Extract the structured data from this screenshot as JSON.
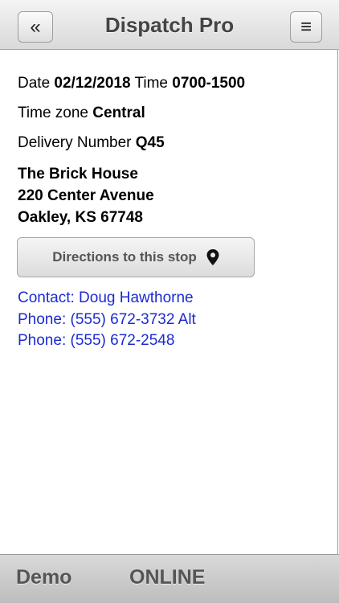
{
  "header": {
    "back_icon": "double-chevron-left-icon",
    "back_glyph": "«",
    "title": "Dispatch Pro",
    "menu_icon": "hamburger-menu-icon",
    "menu_glyph": "≡"
  },
  "stop": {
    "date_label": "Date",
    "date_value": "02/12/2018",
    "time_label": "Time",
    "time_value": "0700-1500",
    "timezone_label": "Time zone",
    "timezone_value": "Central",
    "delivery_label": "Delivery Number",
    "delivery_value": "Q45",
    "address": {
      "name": "The Brick House",
      "street": "220 Center Avenue",
      "city_line": "Oakley, KS 67748"
    },
    "directions_button": "Directions to this stop",
    "directions_icon": "map-pin-icon",
    "contact_line": "Contact: Doug Hawthorne",
    "phone_1": "Phone: (555) 672-3732 Alt",
    "phone_2": "Phone: (555) 672-2548"
  },
  "footer": {
    "mode": "Demo",
    "status": "ONLINE"
  },
  "colors": {
    "link": "#1b2bd1",
    "title_text": "#444444"
  }
}
